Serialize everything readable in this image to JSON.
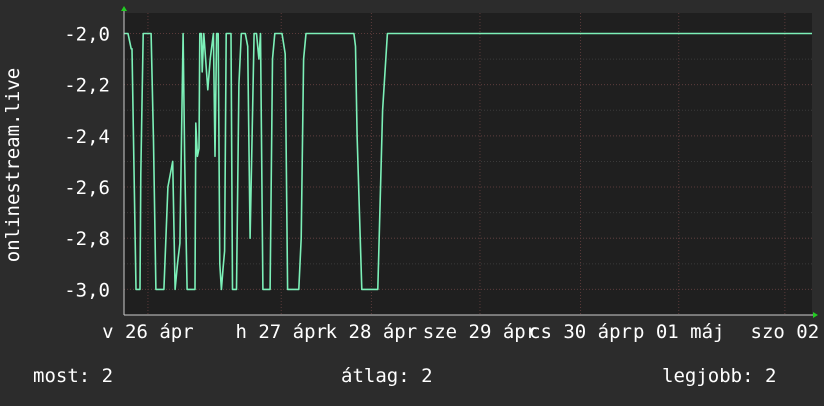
{
  "colors": {
    "background": "#2c2c2c",
    "plot_background": "#1f1f1f",
    "grid_major": "#5a3a3a",
    "grid_minor": "#3a3a3a",
    "text": "#ffffff",
    "series": "#7cf0b8",
    "axis_arrow": "#22cc22"
  },
  "chart_data": {
    "type": "line",
    "ylabel": "onlinestream.live",
    "ylim": [
      -3.1,
      -1.92
    ],
    "y_ticks": [
      "-2,0",
      "-2,2",
      "-2,4",
      "-2,6",
      "-2,8",
      "-3,0"
    ],
    "y_tick_values": [
      -2.0,
      -2.2,
      -2.4,
      -2.6,
      -2.8,
      -3.0
    ],
    "xlim": [
      0,
      8.62
    ],
    "x_ticks": [
      {
        "v": 0.3,
        "label": "v 26 ápr"
      },
      {
        "v": 1.97,
        "label": "h 27 ápr"
      },
      {
        "v": 3.1,
        "label": "k 28 ápr"
      },
      {
        "v": 4.46,
        "label": "sze 29 ápr"
      },
      {
        "v": 5.72,
        "label": "cs 30 ápr"
      },
      {
        "v": 6.95,
        "label": "p 01 máj"
      },
      {
        "v": 8.28,
        "label": "szo 02"
      }
    ],
    "series": [
      {
        "x": [
          0.0,
          0.05,
          0.09,
          0.1,
          0.15,
          0.16,
          0.2,
          0.21,
          0.24,
          0.28,
          0.29,
          0.34,
          0.37,
          0.4,
          0.45,
          0.48,
          0.5,
          0.55,
          0.61,
          0.64,
          0.67,
          0.7,
          0.74,
          0.76,
          0.79,
          0.81,
          0.83,
          0.87,
          0.89,
          0.9,
          0.92,
          0.94,
          0.95,
          0.97,
          0.98,
          1.0,
          1.05,
          1.08,
          1.12,
          1.14,
          1.16,
          1.18,
          1.2,
          1.22,
          1.24,
          1.26,
          1.28,
          1.3,
          1.32,
          1.34,
          1.36,
          1.39,
          1.41,
          1.44,
          1.47,
          1.49,
          1.52,
          1.55,
          1.58,
          1.63,
          1.66,
          1.69,
          1.71,
          1.74,
          1.77,
          1.8,
          1.83,
          1.86,
          1.89,
          1.92,
          1.95,
          1.98,
          2.02,
          2.05,
          2.08,
          2.13,
          2.16,
          2.19,
          2.22,
          2.25,
          2.28,
          2.31,
          2.34,
          2.37,
          2.4,
          2.44,
          2.47,
          2.5,
          2.54,
          2.57,
          2.6,
          2.66,
          2.69,
          2.72,
          2.76,
          2.8,
          2.84,
          2.88,
          2.9,
          2.92,
          2.98,
          3.05,
          3.12,
          3.18,
          3.24,
          3.3,
          3.4,
          3.46,
          3.49,
          3.52,
          3.54,
          3.56,
          3.58,
          3.62,
          3.7,
          3.8,
          3.9,
          3.96,
          4.02,
          4.04,
          4.06,
          4.08,
          4.1,
          4.13,
          4.16,
          4.2,
          4.24,
          4.28,
          4.33,
          4.37,
          4.41,
          4.45,
          4.49,
          4.54,
          4.6,
          4.66,
          4.7,
          4.74,
          4.79,
          4.84,
          4.9,
          4.96,
          5.02,
          5.06,
          5.1,
          5.14,
          5.18,
          5.21,
          5.24,
          5.27,
          5.3,
          5.33,
          5.36,
          5.38,
          5.41,
          5.44,
          5.47,
          5.5,
          5.54,
          5.58,
          5.61,
          5.64,
          5.66,
          5.68,
          5.71,
          5.74,
          5.77,
          5.8,
          5.83,
          5.86,
          5.89,
          5.92,
          5.94,
          5.96,
          5.99,
          6.02,
          6.05,
          6.08,
          6.11,
          6.14,
          6.17,
          6.2,
          6.24,
          6.28,
          6.32,
          6.38,
          6.44,
          6.5,
          6.56,
          6.62,
          6.68,
          6.74,
          6.8,
          6.86,
          6.92,
          6.98,
          7.02,
          7.06,
          7.1,
          7.14,
          7.18,
          7.22,
          7.26,
          7.3,
          7.34,
          7.38,
          7.42,
          7.46,
          7.5,
          7.54,
          7.58,
          7.62,
          7.66,
          7.7,
          7.74,
          7.78,
          7.82,
          7.86,
          7.9,
          7.94,
          7.98,
          8.02,
          8.06,
          8.1,
          8.14,
          8.18,
          8.22,
          8.26,
          8.3,
          8.34,
          8.38,
          8.42,
          8.46,
          8.5,
          8.54,
          8.58,
          8.62
        ],
        "y": [
          -2.0,
          -2.0,
          -2.06,
          -2.06,
          -3.0,
          -3.0,
          -3.0,
          -2.55,
          -2.0,
          -2.0,
          -2.0,
          -2.0,
          -2.42,
          -3.0,
          -3.0,
          -3.0,
          -3.0,
          -2.6,
          -2.5,
          -3.0,
          -2.9,
          -2.82,
          -2.0,
          -2.5,
          -3.0,
          -3.0,
          -3.0,
          -3.0,
          -3.0,
          -2.35,
          -2.48,
          -2.45,
          -2.0,
          -2.0,
          -2.15,
          -2.0,
          -2.22,
          -2.1,
          -2.0,
          -2.48,
          -2.0,
          -2.0,
          -2.9,
          -3.0,
          -2.92,
          -2.85,
          -2.0,
          -2.0,
          -2.0,
          -2.0,
          -3.0,
          -3.0,
          -3.0,
          -2.2,
          -2.0,
          -2.0,
          -2.0,
          -2.05,
          -2.8,
          -2.0,
          -2.0,
          -2.1,
          -2.0,
          -3.0,
          -3.0,
          -3.0,
          -3.0,
          -2.1,
          -2.0,
          -2.0,
          -2.0,
          -2.0,
          -2.08,
          -3.0,
          -3.0,
          -3.0,
          -3.0,
          -3.0,
          -2.8,
          -2.1,
          -2.0,
          -2.0,
          -2.0,
          -2.0,
          -2.0,
          -2.0,
          -2.0,
          -2.0,
          -2.0,
          -2.0,
          -2.0,
          -2.0,
          -2.0,
          -2.0,
          -2.0,
          -2.0,
          -2.0,
          -2.0,
          -2.05,
          -2.4,
          -3.0,
          -3.0,
          -3.0,
          -3.0,
          -2.3,
          -2.0,
          -2.0,
          -2.0,
          -2.0,
          -2.0,
          -2.0,
          -2.0,
          -2.0,
          -2.0,
          -2.0,
          -2.0,
          -2.0,
          -2.0,
          -2.0,
          -2.0,
          -2.0,
          -2.0,
          -2.0,
          -2.0,
          -2.0,
          -2.0,
          -2.0,
          -2.0,
          -2.0,
          -2.0,
          -2.0,
          -2.0,
          -2.0,
          -2.0,
          -2.0,
          -2.0,
          -2.0,
          -2.0,
          -2.0,
          -2.0,
          -2.0,
          -2.0,
          -2.0,
          -2.0,
          -2.0,
          -2.0,
          -2.0,
          -2.0,
          -2.0,
          -2.0,
          -2.0,
          -2.0,
          -2.0,
          -2.0,
          -2.0,
          -2.0,
          -2.0,
          -2.0,
          -2.0,
          -2.0,
          -2.0,
          -2.0,
          -2.0,
          -2.0,
          -2.0,
          -2.0,
          -2.0,
          -2.0,
          -2.0,
          -2.0,
          -2.0,
          -2.0,
          -2.0,
          -2.0,
          -2.0,
          -2.0,
          -2.0,
          -2.0,
          -2.0,
          -2.0,
          -2.0,
          -2.0,
          -2.0,
          -2.0,
          -2.0,
          -2.0,
          -2.0,
          -2.0,
          -2.0,
          -2.0,
          -2.0,
          -2.0,
          -2.0,
          -2.0,
          -2.0,
          -2.0,
          -2.0,
          -2.0,
          -2.0,
          -2.0,
          -2.0,
          -2.0,
          -2.0,
          -2.0,
          -2.0,
          -2.0,
          -2.0,
          -2.0,
          -2.0,
          -2.0,
          -2.0,
          -2.0,
          -2.0,
          -2.0,
          -2.0,
          -2.0,
          -2.0,
          -2.0,
          -2.0,
          -2.0,
          -2.0,
          -2.0,
          -2.0,
          -2.0,
          -2.0,
          -2.0,
          -2.0,
          -2.0,
          -2.0,
          -2.0,
          -2.0,
          -2.0,
          -2.0,
          -2.0,
          -2.0,
          -2.0,
          -2.0
        ]
      }
    ]
  },
  "legend": {
    "now": "most: 2",
    "avg": "átlag: 2",
    "best": "legjobb: 2"
  }
}
